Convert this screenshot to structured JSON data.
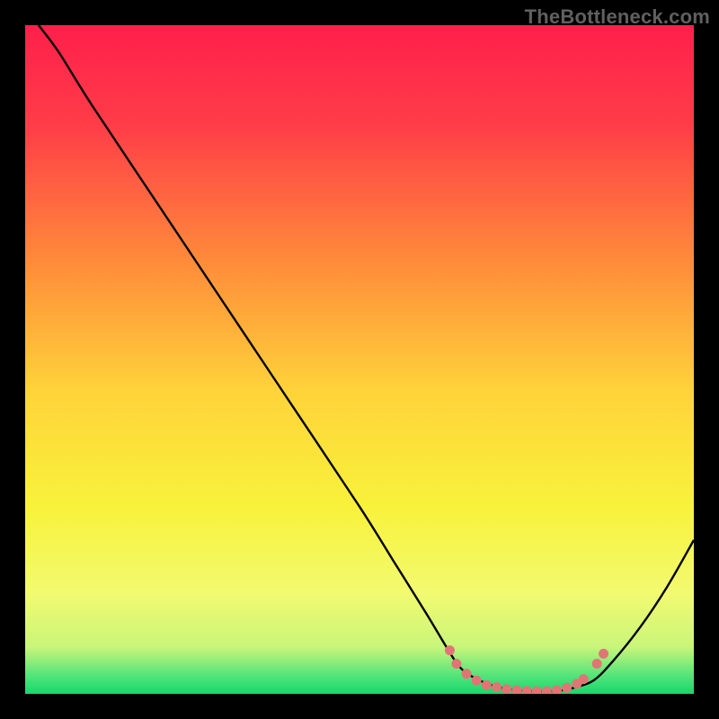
{
  "watermark": "TheBottleneck.com",
  "chart_data": {
    "type": "line",
    "title": "",
    "xlabel": "",
    "ylabel": "",
    "xlim": [
      0,
      100
    ],
    "ylim": [
      0,
      100
    ],
    "grid": false,
    "legend": false,
    "series": [
      {
        "name": "bottleneck-curve",
        "color": "#000000",
        "x": [
          2,
          5,
          10,
          20,
          30,
          40,
          50,
          55,
          60,
          63,
          65,
          67,
          70,
          73,
          76,
          78,
          80,
          82,
          85,
          88,
          92,
          96,
          100
        ],
        "y": [
          100,
          96,
          88,
          73,
          58,
          43,
          28,
          20,
          12,
          7,
          4,
          2.5,
          1.2,
          0.6,
          0.4,
          0.4,
          0.5,
          0.9,
          2,
          5,
          10,
          16,
          23
        ]
      }
    ],
    "markers": {
      "name": "highlight-band",
      "color": "#e17575",
      "points": [
        {
          "x": 63.5,
          "y": 6.5
        },
        {
          "x": 64.5,
          "y": 4.5
        },
        {
          "x": 66.0,
          "y": 3.0
        },
        {
          "x": 67.5,
          "y": 2.0
        },
        {
          "x": 69.0,
          "y": 1.3
        },
        {
          "x": 70.5,
          "y": 1.0
        },
        {
          "x": 72.0,
          "y": 0.7
        },
        {
          "x": 73.5,
          "y": 0.55
        },
        {
          "x": 75.0,
          "y": 0.45
        },
        {
          "x": 76.5,
          "y": 0.4
        },
        {
          "x": 78.0,
          "y": 0.42
        },
        {
          "x": 79.5,
          "y": 0.55
        },
        {
          "x": 81.0,
          "y": 0.9
        },
        {
          "x": 82.5,
          "y": 1.5
        },
        {
          "x": 83.5,
          "y": 2.2
        },
        {
          "x": 85.5,
          "y": 4.5
        },
        {
          "x": 86.5,
          "y": 6.0
        }
      ]
    },
    "gradient": {
      "stops": [
        {
          "offset": 0.0,
          "color": "#ff1f4b"
        },
        {
          "offset": 0.15,
          "color": "#ff3d48"
        },
        {
          "offset": 0.35,
          "color": "#ff8a3a"
        },
        {
          "offset": 0.55,
          "color": "#ffd43a"
        },
        {
          "offset": 0.72,
          "color": "#f8f23b"
        },
        {
          "offset": 0.85,
          "color": "#f2fa70"
        },
        {
          "offset": 0.93,
          "color": "#c9f57a"
        },
        {
          "offset": 0.975,
          "color": "#4ee37a"
        },
        {
          "offset": 1.0,
          "color": "#17d86b"
        }
      ]
    }
  }
}
